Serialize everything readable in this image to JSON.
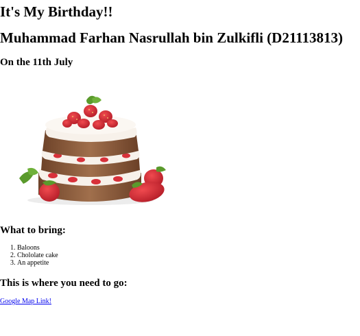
{
  "header": {
    "title": "It's My Birthday!!",
    "name": "Muhammad Farhan Nasrullah bin Zulkifli (D21113813)",
    "date": "On the 11th July"
  },
  "cake_image": {
    "icon": "cake-icon",
    "colors": {
      "sponge": "#8a5a3c",
      "cream": "#f7f1ea",
      "strawberry": "#d8313a",
      "leaf": "#5a9a2c"
    }
  },
  "bring": {
    "heading": "What to bring:",
    "items": [
      "Baloons",
      "Chololate cake",
      "An appetite"
    ]
  },
  "location": {
    "heading": "This is where you need to go:",
    "link_text": "Google Map Link!"
  }
}
